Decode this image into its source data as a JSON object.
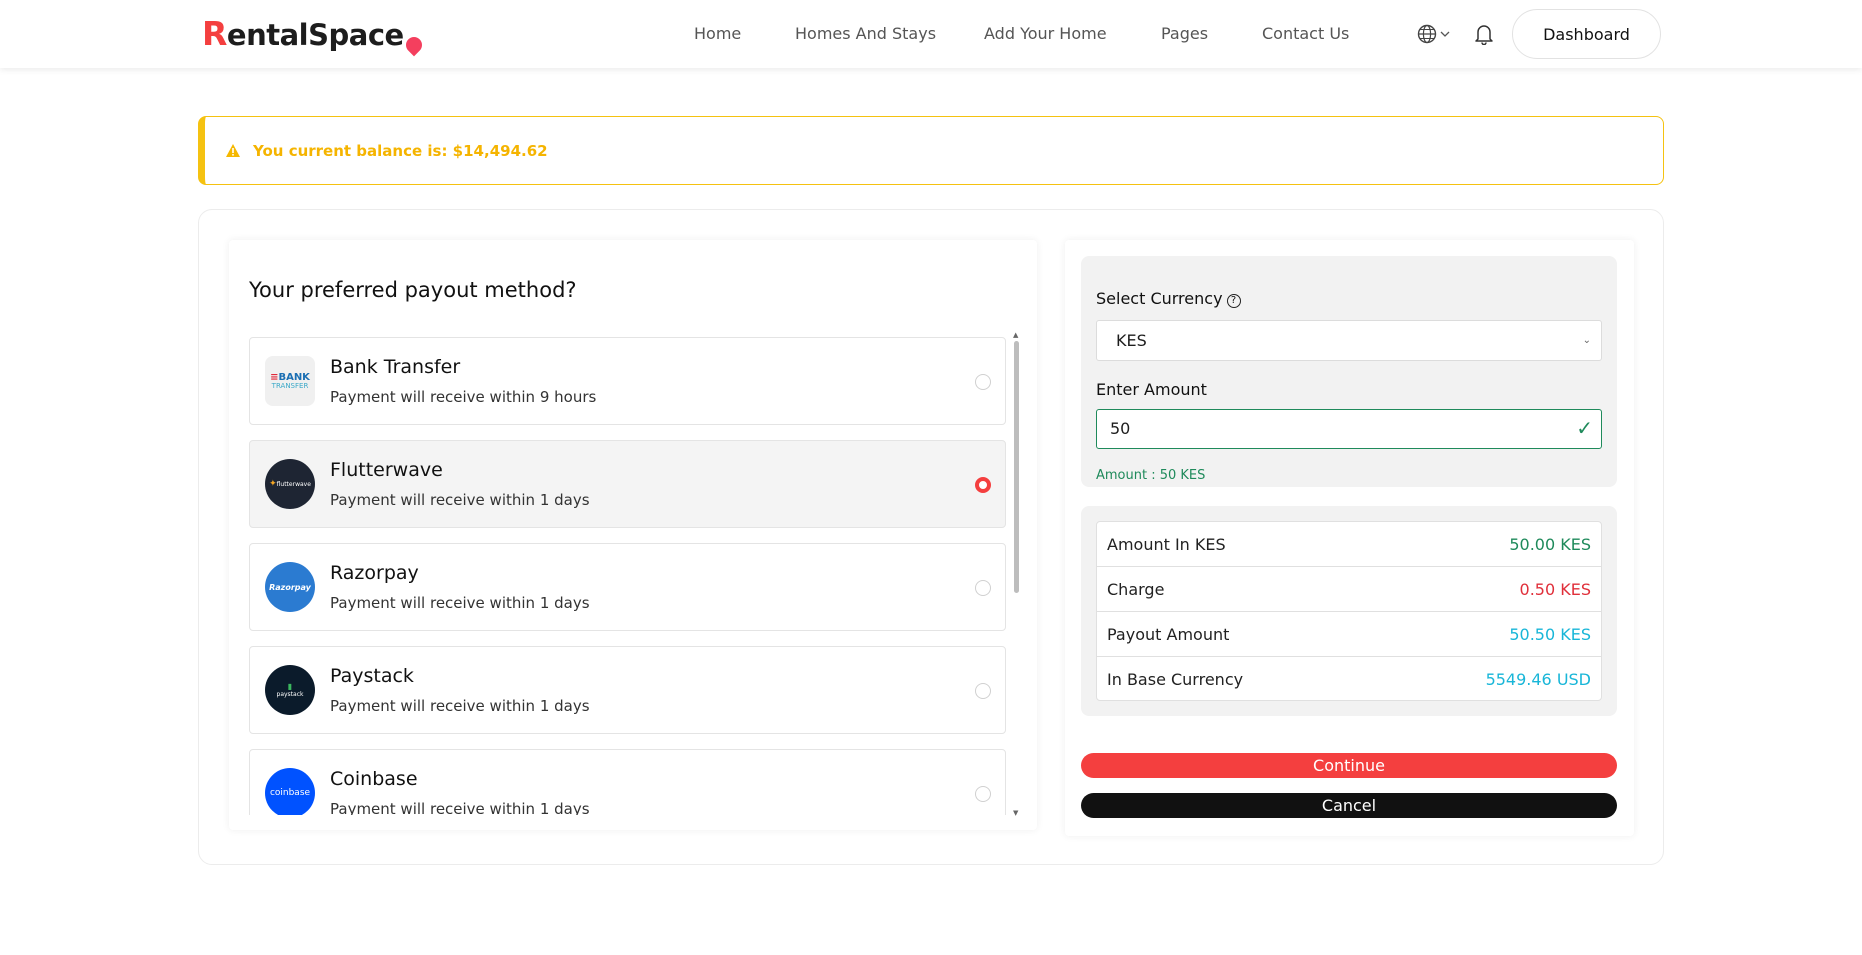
{
  "header": {
    "logo_first": "R",
    "logo_rest": "entalSpac",
    "logo_last": "e",
    "nav": [
      "Home",
      "Homes And Stays",
      "Add Your Home",
      "Pages",
      "Contact Us"
    ],
    "dashboard_label": "Dashboard"
  },
  "alert": {
    "text": "You current balance is: $14,494.62"
  },
  "payout": {
    "heading": "Your preferred payout method?",
    "methods": [
      {
        "name": "Bank Transfer",
        "sub": "Payment will receive within 9 hours",
        "logo": "BANK TRANSFER"
      },
      {
        "name": "Flutterwave",
        "sub": "Payment will receive within 1 days",
        "logo": "flutterwave"
      },
      {
        "name": "Razorpay",
        "sub": "Payment will receive within 1 days",
        "logo": "Razorpay"
      },
      {
        "name": "Paystack",
        "sub": "Payment will receive within 1 days",
        "logo": "paystack"
      },
      {
        "name": "Coinbase",
        "sub": "Payment will receive within 1 days",
        "logo": "coinbase"
      }
    ],
    "selected_index": 1
  },
  "form": {
    "currency_label": "Select Currency",
    "currency_value": "KES",
    "amount_label": "Enter Amount",
    "amount_value": "50",
    "amount_note": "Amount : 50 KES"
  },
  "summary": [
    {
      "label": "Amount In KES",
      "value": "50.00 KES",
      "color": "#1f8a5b"
    },
    {
      "label": "Charge",
      "value": "0.50 KES",
      "color": "#e02f3a"
    },
    {
      "label": "Payout Amount",
      "value": "50.50 KES",
      "color": "#18b6d8"
    },
    {
      "label": "In Base Currency",
      "value": "5549.46 USD",
      "color": "#18b6d8"
    }
  ],
  "buttons": {
    "continue": "Continue",
    "cancel": "Cancel"
  },
  "colors": {
    "brand": "#f43f3f",
    "warning": "#f5c211",
    "success": "#1f8a5b"
  }
}
